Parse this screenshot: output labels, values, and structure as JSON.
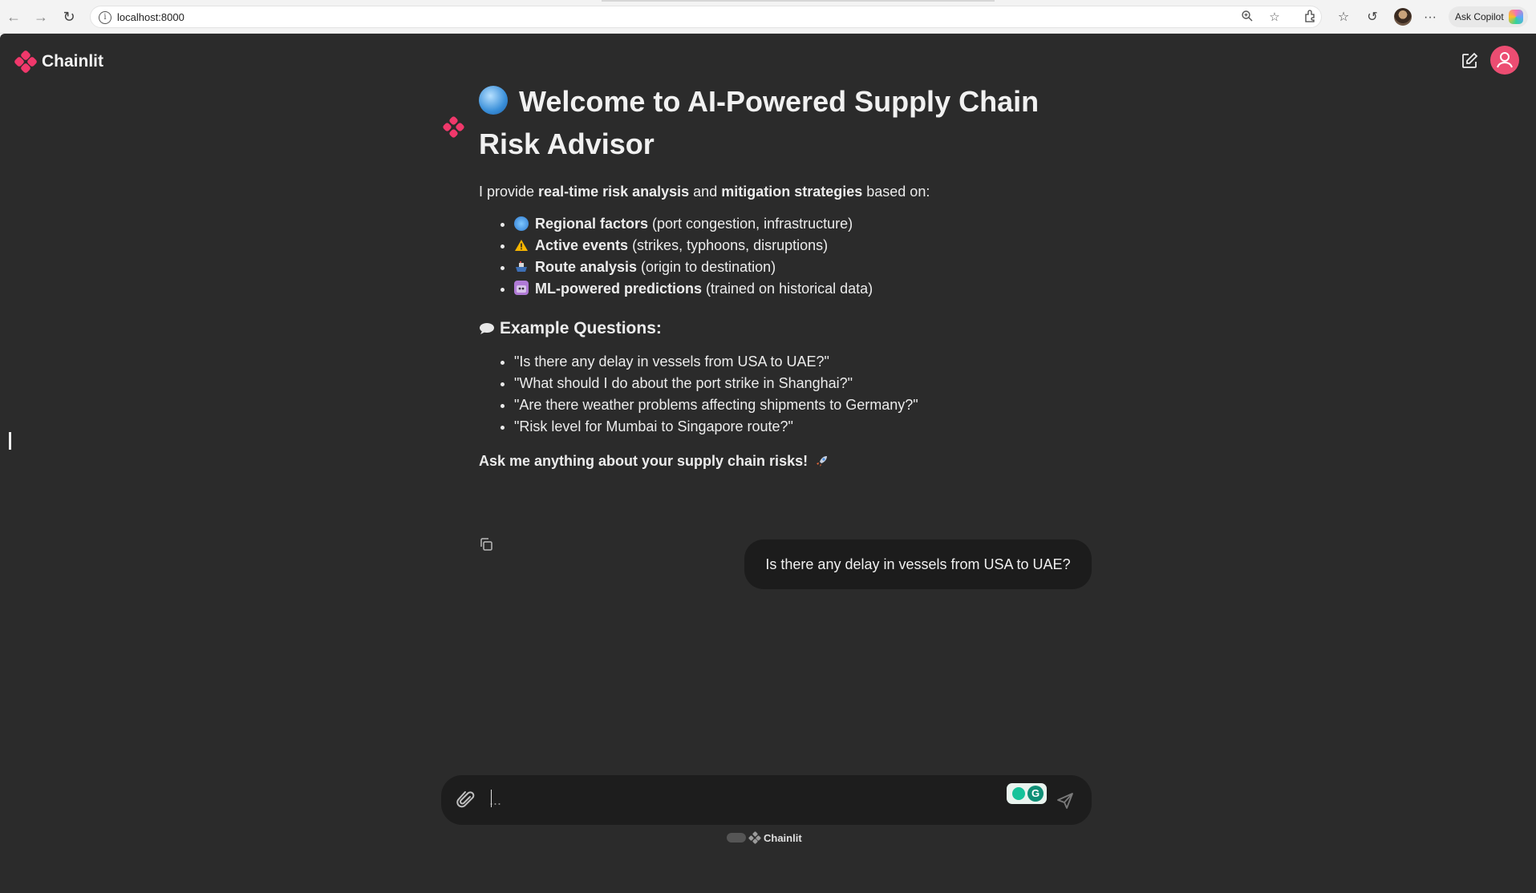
{
  "browser": {
    "url": "localhost:8000",
    "copilot_label": "Ask Copilot"
  },
  "app": {
    "brand_name": "Chainlit",
    "accent_color": "#f0386b"
  },
  "message": {
    "title": "Welcome to AI-Powered Supply Chain Risk Advisor",
    "intro": {
      "pre": "I provide ",
      "bold1": "real-time risk analysis",
      "mid": " and ",
      "bold2": "mitigation strategies",
      "post": " based on:"
    },
    "features": [
      {
        "icon": "earth-globe-icon",
        "bold": "Regional factors",
        "rest": " (port congestion, infrastructure)"
      },
      {
        "icon": "warning-icon",
        "bold": "Active events",
        "rest": " (strikes, typhoons, disruptions)"
      },
      {
        "icon": "ship-icon",
        "bold": "Route analysis",
        "rest": " (origin to destination)"
      },
      {
        "icon": "robot-icon",
        "bold": "ML-powered predictions",
        "rest": " (trained on historical data)"
      }
    ],
    "examples_heading": "Example Questions:",
    "examples": [
      "\"Is there any delay in vessels from USA to UAE?\"",
      "\"What should I do about the port strike in Shanghai?\"",
      "\"Are there weather problems affecting shipments to Germany?\"",
      "\"Risk level for Mumbai to Singapore route?\""
    ],
    "outro": "Ask me anything about your supply chain risks!"
  },
  "user_message": "Is there any delay in vessels from USA to UAE?",
  "composer": {
    "placeholder": "..."
  },
  "footer": {
    "label": "Chainlit"
  }
}
